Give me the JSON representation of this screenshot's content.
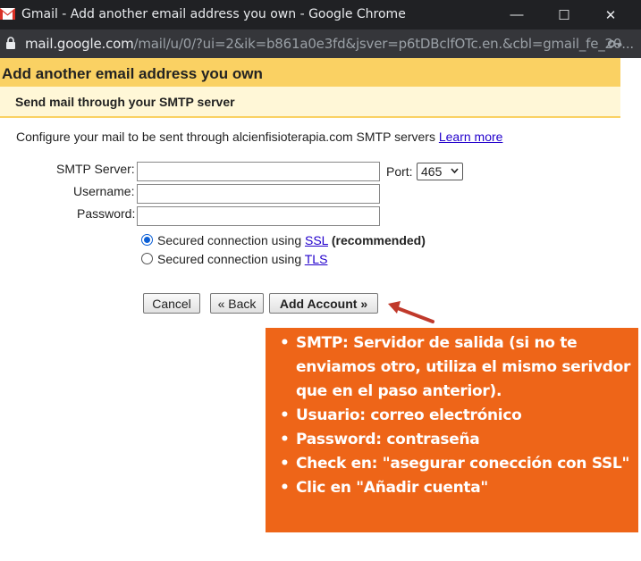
{
  "window": {
    "title": "Gmail - Add another email address you own - Google Chrome",
    "minimize_glyph": "—",
    "maximize_glyph": "☐",
    "close_glyph": "✕"
  },
  "address_bar": {
    "host": "mail.google.com",
    "path": "/mail/u/0/?ui=2&ik=b861a0e3fd&jsver=p6tDBclfOTc.en.&cbl=gmail_fe_20..."
  },
  "page": {
    "title": "Add another email address you own",
    "section_title": "Send mail through your SMTP server",
    "config_text": "Configure your mail to be sent through alcienfisioterapia.com SMTP servers",
    "learn_more": "Learn more"
  },
  "form": {
    "smtp_label": "SMTP Server:",
    "smtp_value": "",
    "username_label": "Username:",
    "username_value": "",
    "password_label": "Password:",
    "password_value": "",
    "port_label": "Port:",
    "port_value": "465",
    "ssl_prefix": "Secured connection using",
    "ssl_link": "SSL",
    "ssl_suffix": "(recommended)",
    "tls_prefix": "Secured connection using",
    "tls_link": "TLS",
    "selected_connection": "SSL"
  },
  "buttons": {
    "cancel": "Cancel",
    "back": "« Back",
    "add_account": "Add Account »"
  },
  "note": {
    "items": [
      "SMTP: Servidor de salida (si no te enviamos otro, utiliza el mismo serivdor que en el paso anterior).",
      "Usuario: correo electrónico",
      "Password: contraseña",
      "Check en: \"asegurar conección con SSL\"",
      "Clic en \"Añadir cuenta\""
    ]
  },
  "colors": {
    "title_bar": "#202124",
    "address_bar": "#35363a",
    "page_header": "#fad163",
    "section_bg": "#fff7d7",
    "link": "#2200cc",
    "note_bg": "#ee6518",
    "arrow": "#c0392b"
  }
}
